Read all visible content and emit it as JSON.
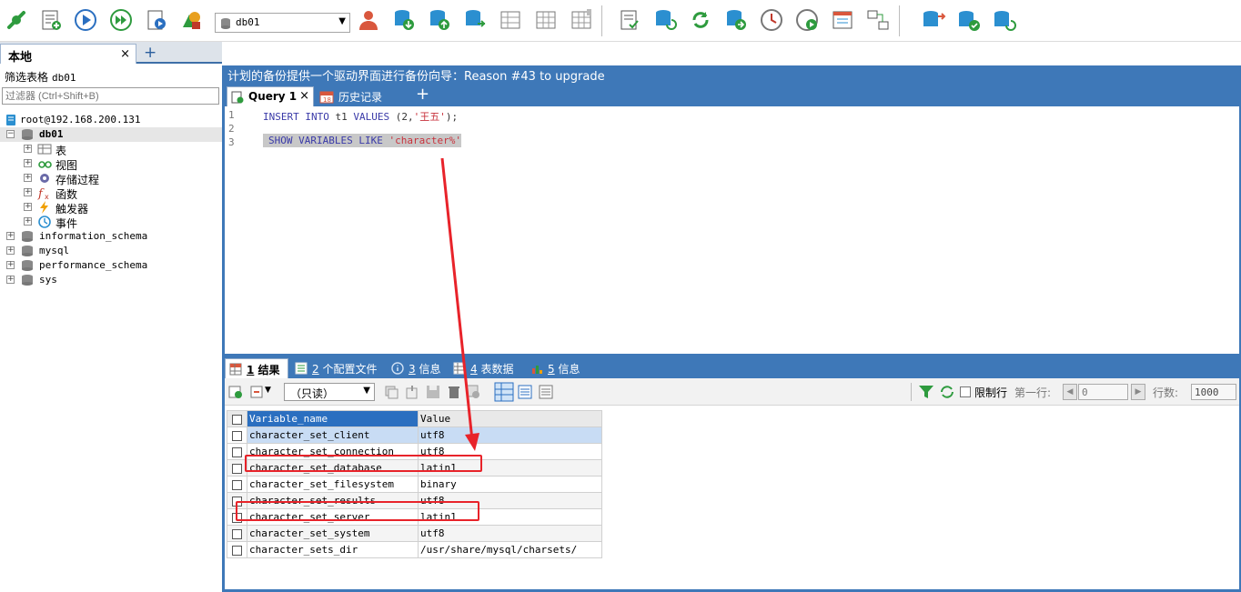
{
  "toolbar": {
    "db_select_value": "db01",
    "icons": [
      "connection-icon",
      "new-query-icon",
      "run-icon",
      "run-all-icon",
      "run-script-icon",
      "schema-icon",
      "user-icon",
      "backup-icon",
      "restore-icon",
      "sync-icon",
      "compare-icon",
      "table-grid-icon",
      "table-grid2-icon",
      "report-icon",
      "refresh-db-icon",
      "reload-icon",
      "db-add-icon",
      "scheduler-icon",
      "play-next-icon",
      "window-icon",
      "diagram-icon",
      "db-stack-icon",
      "db-check-icon",
      "db-sync-icon"
    ]
  },
  "left": {
    "tab_label": "本地",
    "tab_close": "×",
    "add_tab": "+",
    "filter_label": "筛选表格",
    "filter_db": "db01",
    "filter_placeholder": "过滤器 (Ctrl+Shift+B)",
    "tree": {
      "connection": "root@192.168.200.131",
      "db01": "db01",
      "db01_children": [
        "表",
        "视图",
        "存储过程",
        "函数",
        "触发器",
        "事件"
      ],
      "other_dbs": [
        "information_schema",
        "mysql",
        "performance_schema",
        "sys"
      ]
    }
  },
  "main": {
    "info_bar": "计划的备份提供一个驱动界面进行备份向导：Reason #43 to upgrade",
    "query_tab": "Query 1",
    "query_tab_close": "×",
    "history_tab": "历史记录",
    "add_tab": "+",
    "editor": {
      "line_numbers": [
        "1",
        "2",
        "3"
      ],
      "line1": {
        "kw1": "INSERT",
        "kw2": "INTO",
        "ident": "t1",
        "kw3": "VALUES",
        "pre": "(2,",
        "str": "'王五'",
        "post": ");"
      },
      "line3": {
        "kw1": "SHOW",
        "kw2": "VARIABLES",
        "kw3": "LIKE",
        "str": "'character%'"
      }
    },
    "result_tabs": [
      {
        "num": "1",
        "label": " 结果"
      },
      {
        "num": "2",
        "label": " 个配置文件"
      },
      {
        "num": "3",
        "label": " 信息"
      },
      {
        "num": "4",
        "label": " 表数据"
      },
      {
        "num": "5",
        "label": " 信息"
      }
    ],
    "result_toolbar": {
      "readonly": "（只读）",
      "limit_rows": "限制行",
      "first_row_label": "第一行:",
      "first_row_value": "0",
      "rows_label": "行数:",
      "rows_value": "1000"
    },
    "grid": {
      "headers": [
        "Variable_name",
        "Value"
      ],
      "rows": [
        [
          "character_set_client",
          "utf8"
        ],
        [
          "character_set_connection",
          "utf8"
        ],
        [
          "character_set_database",
          "latin1"
        ],
        [
          "character_set_filesystem",
          "binary"
        ],
        [
          "character_set_results",
          "utf8"
        ],
        [
          "character_set_server",
          "latin1"
        ],
        [
          "character_set_system",
          "utf8"
        ],
        [
          "character_sets_dir",
          "/usr/share/mysql/charsets/"
        ]
      ]
    }
  },
  "colors": {
    "accent_blue": "#3e78b8",
    "highlight_red": "#e8232a"
  }
}
